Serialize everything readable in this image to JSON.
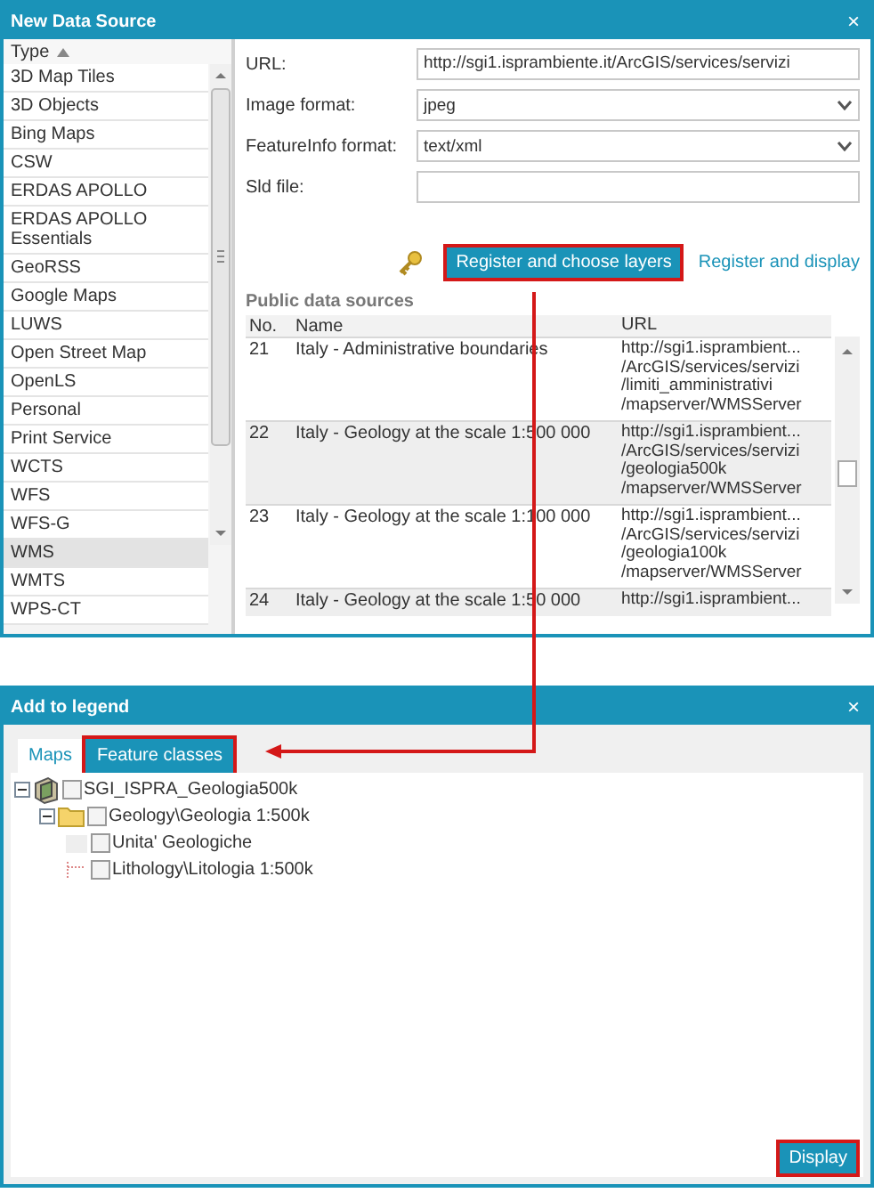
{
  "data_source_window": {
    "title": "New Data Source",
    "close": "×",
    "type_list": {
      "header": "Type",
      "items": [
        {
          "label": "3D Map Tiles",
          "selected": false
        },
        {
          "label": "3D Objects",
          "selected": false
        },
        {
          "label": "Bing Maps",
          "selected": false
        },
        {
          "label": "CSW",
          "selected": false
        },
        {
          "label": "ERDAS APOLLO",
          "selected": false
        },
        {
          "label": "ERDAS APOLLO Essentials",
          "selected": false
        },
        {
          "label": "GeoRSS",
          "selected": false
        },
        {
          "label": "Google Maps",
          "selected": false
        },
        {
          "label": "LUWS",
          "selected": false
        },
        {
          "label": "Open Street Map",
          "selected": false
        },
        {
          "label": "OpenLS",
          "selected": false
        },
        {
          "label": "Personal",
          "selected": false
        },
        {
          "label": "Print Service",
          "selected": false
        },
        {
          "label": "WCTS",
          "selected": false
        },
        {
          "label": "WFS",
          "selected": false
        },
        {
          "label": "WFS-G",
          "selected": false
        },
        {
          "label": "WMS",
          "selected": true
        },
        {
          "label": "WMTS",
          "selected": false
        },
        {
          "label": "WPS-CT",
          "selected": false
        }
      ]
    },
    "fields": [
      {
        "label": "URL:",
        "kind": "text",
        "value": "http://sgi1.isprambiente.it/ArcGIS/services/servizi"
      },
      {
        "label": "Image format:",
        "kind": "select",
        "value": "jpeg"
      },
      {
        "label": "FeatureInfo format:",
        "kind": "select",
        "value": "text/xml"
      },
      {
        "label": "Sld file:",
        "kind": "text"
      }
    ],
    "actions": [
      {
        "label": "Register and choose layers",
        "kind": "button",
        "highlighted": true
      },
      {
        "label": "Register and display",
        "kind": "link",
        "highlighted": false
      }
    ],
    "public_sources": {
      "title": "Public data sources",
      "columns": [
        "No.",
        "Name",
        "URL"
      ],
      "rows": [
        {
          "no": "21",
          "name": "Italy - Administrative boundaries",
          "url": [
            "http://sgi1.isprambient...",
            "/ArcGIS/services/servizi",
            "/limiti_amministrativi",
            "/mapserver/WMSServer"
          ]
        },
        {
          "no": "22",
          "name": "Italy - Geology at the scale 1:500 000",
          "url": [
            "http://sgi1.isprambient...",
            "/ArcGIS/services/servizi",
            "/geologia500k",
            "/mapserver/WMSServer"
          ]
        },
        {
          "no": "23",
          "name": "Italy - Geology at the scale 1:100 000",
          "url": [
            "http://sgi1.isprambient...",
            "/ArcGIS/services/servizi",
            "/geologia100k",
            "/mapserver/WMSServer"
          ]
        },
        {
          "no": "24",
          "name": "Italy - Geology at the scale 1:50 000",
          "url": [
            "http://sgi1.isprambient..."
          ]
        }
      ]
    }
  },
  "legend_window": {
    "title": "Add to legend",
    "close": "×",
    "tabs": [
      {
        "label": "Maps",
        "selected": false,
        "highlighted": false
      },
      {
        "label": "Feature classes",
        "selected": true,
        "highlighted": true
      }
    ],
    "tree": [
      {
        "label": "SGI_ISPRA_Geologia500k",
        "kind": "map",
        "checked": false,
        "expanded": true,
        "children": [
          {
            "label": "Geology\\Geologia 1:500k",
            "kind": "folder",
            "checked": false,
            "expanded": true,
            "children": [
              {
                "label": "Unita' Geologiche",
                "kind": "class",
                "checked": false
              },
              {
                "label": "Lithology\\Litologia 1:500k",
                "kind": "class",
                "checked": false
              }
            ]
          }
        ]
      }
    ],
    "button": {
      "label": "Display",
      "highlighted": true
    }
  }
}
